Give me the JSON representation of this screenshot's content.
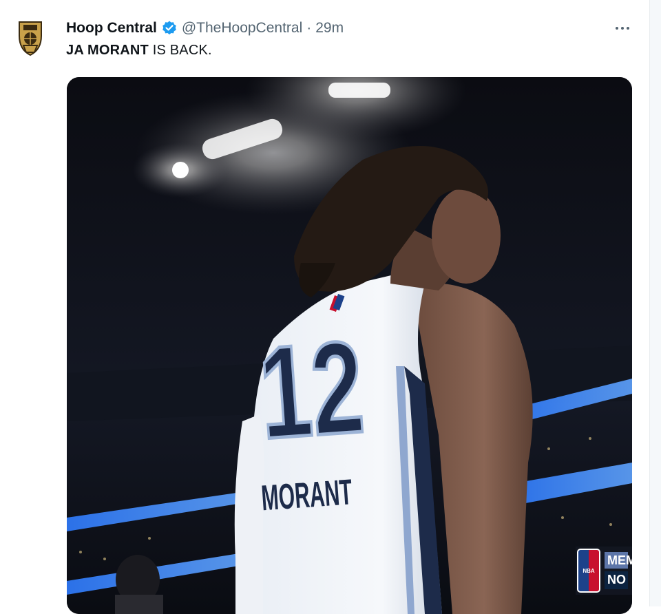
{
  "tweet": {
    "author_name": "Hoop Central",
    "handle": "@TheHoopCentral",
    "separator": "·",
    "time": "29m",
    "text_bold": "JA MORANT",
    "text_rest": " IS BACK.",
    "verified_color": "#1d9bf0"
  },
  "media": {
    "jersey_number": "12",
    "jersey_name": "MORANT",
    "scorebug": {
      "team_top": "MEM",
      "team_bottom": "NO",
      "logo_text": "NBA"
    }
  },
  "icons": {
    "avatar": "hoop-central-logo-icon",
    "verified": "verified-badge-icon",
    "more": "more-options-icon"
  }
}
